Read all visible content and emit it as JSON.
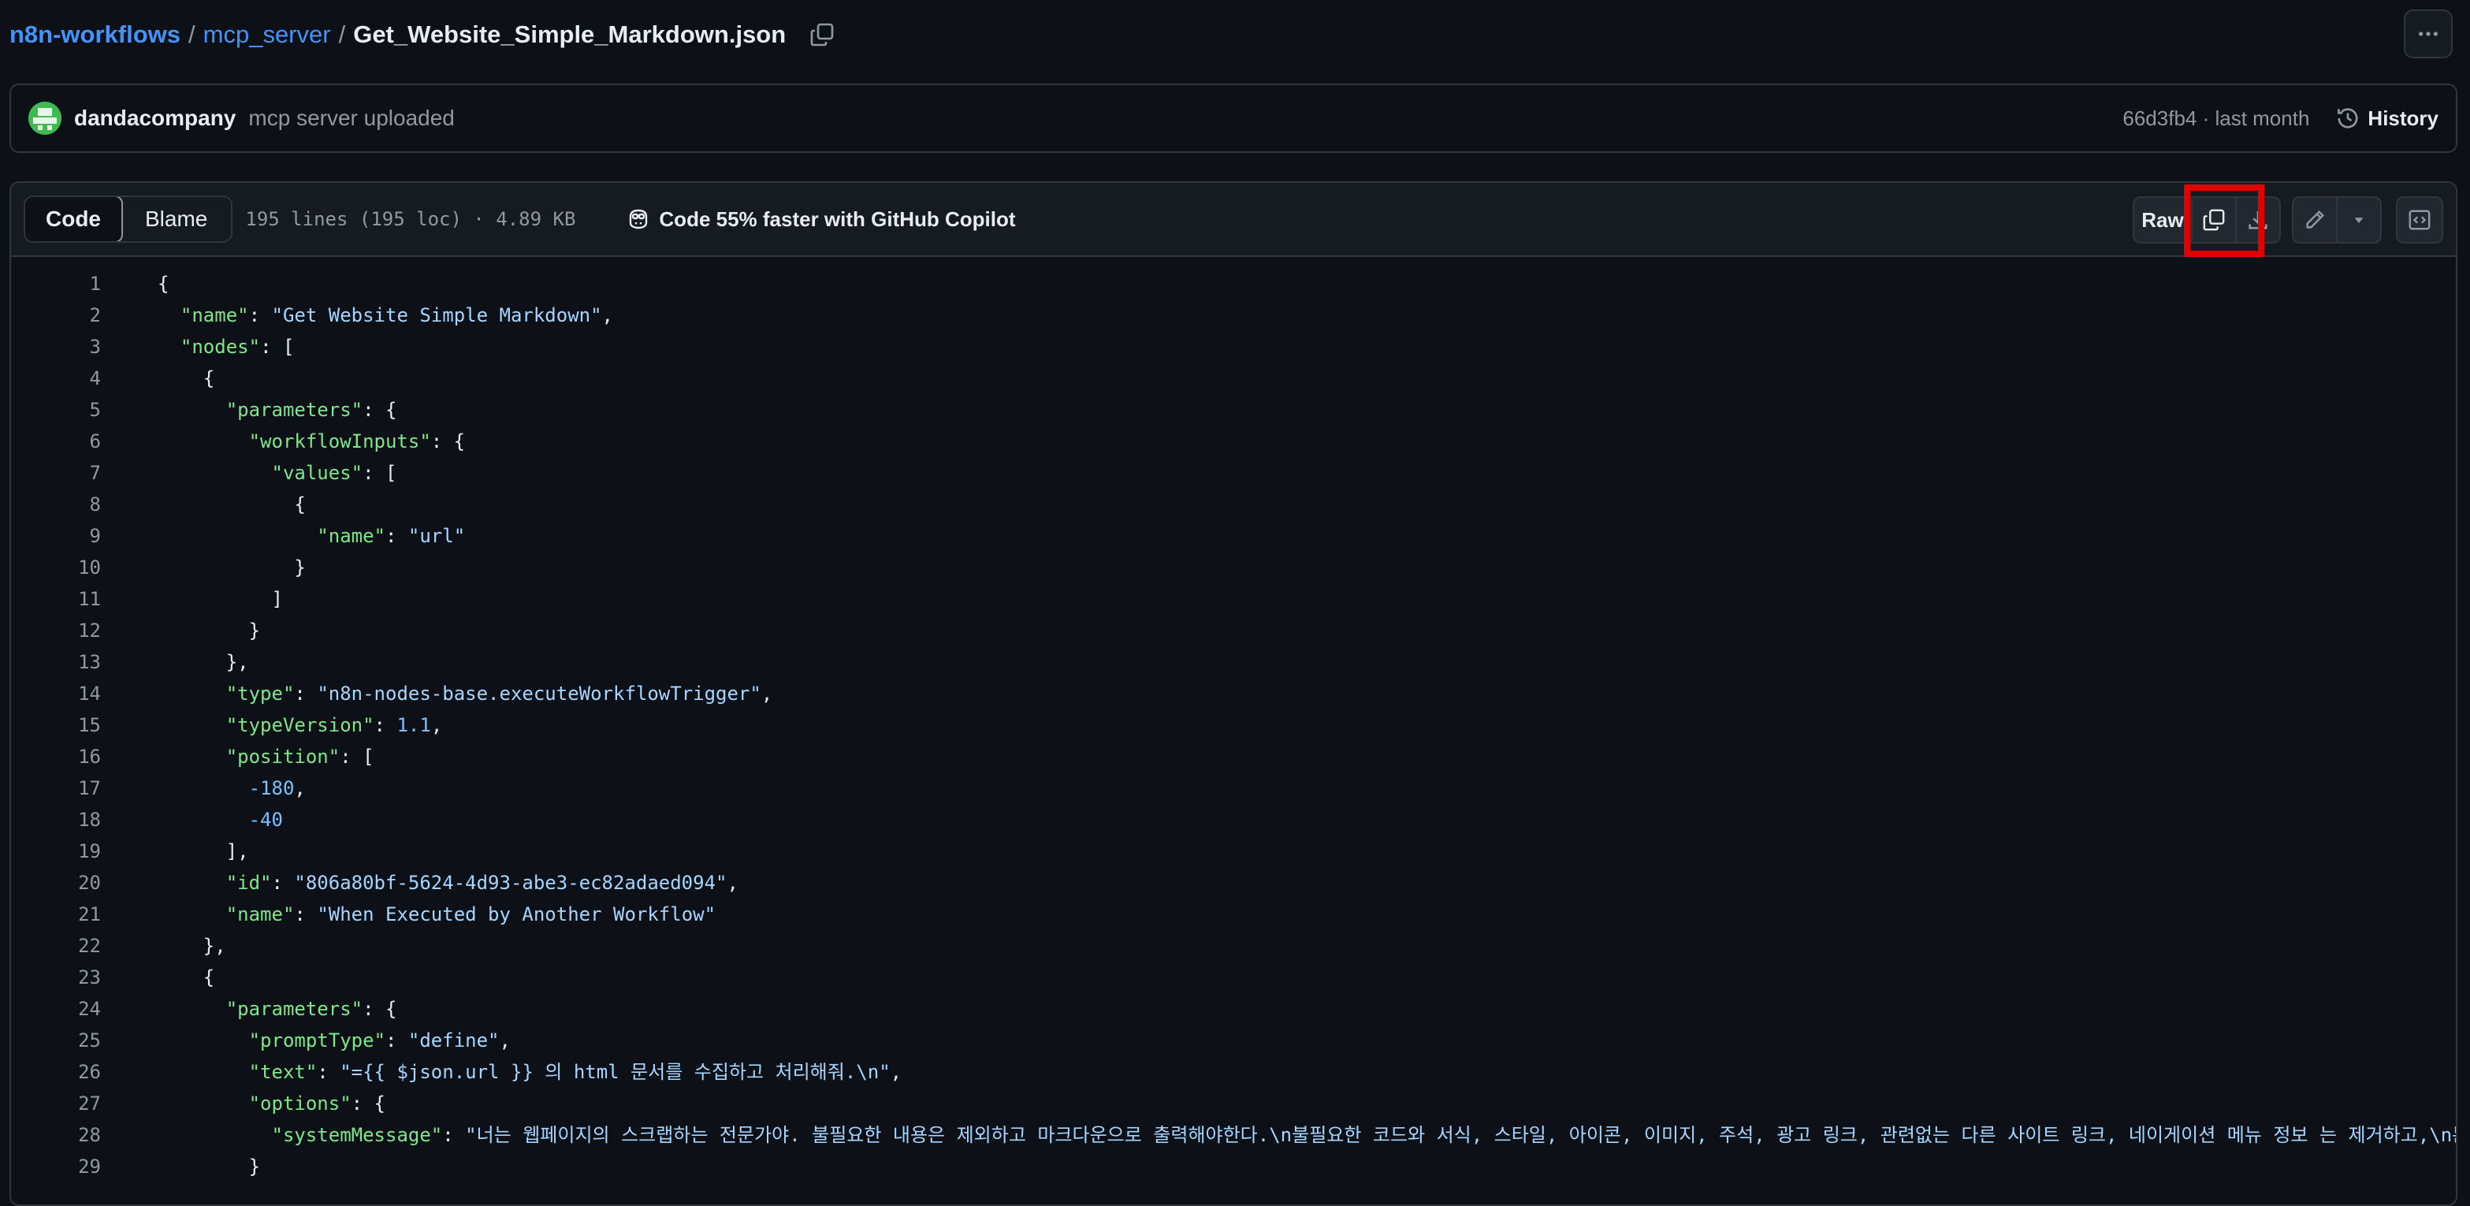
{
  "breadcrumb": {
    "repo": "n8n-workflows",
    "folder": "mcp_server",
    "file": "Get_Website_Simple_Markdown.json",
    "separator": "/"
  },
  "commit": {
    "author": "dandacompany",
    "message": "mcp server uploaded",
    "meta": "66d3fb4 · last month",
    "history_label": "History"
  },
  "file_header": {
    "tabs": [
      "Code",
      "Blame"
    ],
    "info": "195 lines (195 loc) · 4.89 KB",
    "copilot": "Code 55% faster with GitHub Copilot",
    "raw_label": "Raw"
  },
  "icons": [
    "copy-icon",
    "kebab-icon",
    "history-icon",
    "copilot-icon",
    "download-icon",
    "pencil-icon",
    "chevron-down-icon",
    "code-embed-icon"
  ],
  "colors": {
    "background": "#0d1117",
    "link": "#4493f8",
    "key": "#7ee787",
    "string": "#a5d6ff",
    "number": "#79c0ff",
    "highlight": "#e00000"
  },
  "code_lines": [
    [
      {
        "t": "p",
        "v": "{"
      }
    ],
    [
      {
        "t": "p",
        "v": "  "
      },
      {
        "t": "k",
        "v": "\"name\""
      },
      {
        "t": "p",
        "v": ": "
      },
      {
        "t": "s",
        "v": "\"Get Website Simple Markdown\""
      },
      {
        "t": "p",
        "v": ","
      }
    ],
    [
      {
        "t": "p",
        "v": "  "
      },
      {
        "t": "k",
        "v": "\"nodes\""
      },
      {
        "t": "p",
        "v": ": ["
      }
    ],
    [
      {
        "t": "p",
        "v": "    {"
      }
    ],
    [
      {
        "t": "p",
        "v": "      "
      },
      {
        "t": "k",
        "v": "\"parameters\""
      },
      {
        "t": "p",
        "v": ": {"
      }
    ],
    [
      {
        "t": "p",
        "v": "        "
      },
      {
        "t": "k",
        "v": "\"workflowInputs\""
      },
      {
        "t": "p",
        "v": ": {"
      }
    ],
    [
      {
        "t": "p",
        "v": "          "
      },
      {
        "t": "k",
        "v": "\"values\""
      },
      {
        "t": "p",
        "v": ": ["
      }
    ],
    [
      {
        "t": "p",
        "v": "            {"
      }
    ],
    [
      {
        "t": "p",
        "v": "              "
      },
      {
        "t": "k",
        "v": "\"name\""
      },
      {
        "t": "p",
        "v": ": "
      },
      {
        "t": "s",
        "v": "\"url\""
      }
    ],
    [
      {
        "t": "p",
        "v": "            }"
      }
    ],
    [
      {
        "t": "p",
        "v": "          ]"
      }
    ],
    [
      {
        "t": "p",
        "v": "        }"
      }
    ],
    [
      {
        "t": "p",
        "v": "      },"
      }
    ],
    [
      {
        "t": "p",
        "v": "      "
      },
      {
        "t": "k",
        "v": "\"type\""
      },
      {
        "t": "p",
        "v": ": "
      },
      {
        "t": "s",
        "v": "\"n8n-nodes-base.executeWorkflowTrigger\""
      },
      {
        "t": "p",
        "v": ","
      }
    ],
    [
      {
        "t": "p",
        "v": "      "
      },
      {
        "t": "k",
        "v": "\"typeVersion\""
      },
      {
        "t": "p",
        "v": ": "
      },
      {
        "t": "n",
        "v": "1.1"
      },
      {
        "t": "p",
        "v": ","
      }
    ],
    [
      {
        "t": "p",
        "v": "      "
      },
      {
        "t": "k",
        "v": "\"position\""
      },
      {
        "t": "p",
        "v": ": ["
      }
    ],
    [
      {
        "t": "p",
        "v": "        "
      },
      {
        "t": "n",
        "v": "-180"
      },
      {
        "t": "p",
        "v": ","
      }
    ],
    [
      {
        "t": "p",
        "v": "        "
      },
      {
        "t": "n",
        "v": "-40"
      }
    ],
    [
      {
        "t": "p",
        "v": "      ],"
      }
    ],
    [
      {
        "t": "p",
        "v": "      "
      },
      {
        "t": "k",
        "v": "\"id\""
      },
      {
        "t": "p",
        "v": ": "
      },
      {
        "t": "s",
        "v": "\"806a80bf-5624-4d93-abe3-ec82adaed094\""
      },
      {
        "t": "p",
        "v": ","
      }
    ],
    [
      {
        "t": "p",
        "v": "      "
      },
      {
        "t": "k",
        "v": "\"name\""
      },
      {
        "t": "p",
        "v": ": "
      },
      {
        "t": "s",
        "v": "\"When Executed by Another Workflow\""
      }
    ],
    [
      {
        "t": "p",
        "v": "    },"
      }
    ],
    [
      {
        "t": "p",
        "v": "    {"
      }
    ],
    [
      {
        "t": "p",
        "v": "      "
      },
      {
        "t": "k",
        "v": "\"parameters\""
      },
      {
        "t": "p",
        "v": ": {"
      }
    ],
    [
      {
        "t": "p",
        "v": "        "
      },
      {
        "t": "k",
        "v": "\"promptType\""
      },
      {
        "t": "p",
        "v": ": "
      },
      {
        "t": "s",
        "v": "\"define\""
      },
      {
        "t": "p",
        "v": ","
      }
    ],
    [
      {
        "t": "p",
        "v": "        "
      },
      {
        "t": "k",
        "v": "\"text\""
      },
      {
        "t": "p",
        "v": ": "
      },
      {
        "t": "s",
        "v": "\"={{ $json.url }} 의 html 문서를 수집하고 처리해줘.\\n\""
      },
      {
        "t": "p",
        "v": ","
      }
    ],
    [
      {
        "t": "p",
        "v": "        "
      },
      {
        "t": "k",
        "v": "\"options\""
      },
      {
        "t": "p",
        "v": ": {"
      }
    ],
    [
      {
        "t": "p",
        "v": "          "
      },
      {
        "t": "k",
        "v": "\"systemMessage\""
      },
      {
        "t": "p",
        "v": ": "
      },
      {
        "t": "s",
        "v": "\"너는 웹페이지의 스크랩하는 전문가야. 불필요한 내용은 제외하고 마크다운으로 출력해야한다.\\n불필요한 코드와 서식, 스타일, 아이콘, 이미지, 주석, 광고 링크, 관련없는 다른 사이트 링크, 네이게이션 메뉴 정보 는 제거하고,\\n본문 컨텐츠"
      }
    ],
    [
      {
        "t": "p",
        "v": "        }"
      }
    ]
  ]
}
